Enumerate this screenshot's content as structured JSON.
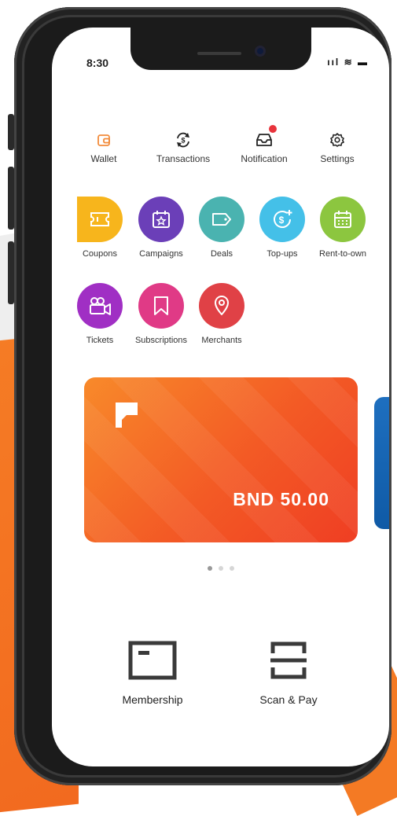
{
  "status_bar": {
    "time": "8:30",
    "indicators": "ııl ≋ ▬"
  },
  "quick_actions": [
    {
      "label": "Wallet",
      "icon": "wallet-icon",
      "color": "#f28b3a"
    },
    {
      "label": "Transactions",
      "icon": "transactions-icon",
      "color": "#222222"
    },
    {
      "label": "Notification",
      "icon": "inbox-icon",
      "color": "#222222",
      "has_badge": true
    },
    {
      "label": "Settings",
      "icon": "gear-icon",
      "color": "#222222"
    }
  ],
  "services": [
    {
      "label": "Coupons",
      "icon": "ticket-icon",
      "color": "#f7b51c"
    },
    {
      "label": "Campaigns",
      "icon": "calendar-star-icon",
      "color": "#6b3fb8"
    },
    {
      "label": "Deals",
      "icon": "tag-icon",
      "color": "#4ab3b0"
    },
    {
      "label": "Top-ups",
      "icon": "dollar-plus-icon",
      "color": "#44c0e8"
    },
    {
      "label": "Rent-to-own",
      "icon": "calendar-icon",
      "color": "#8cc63f"
    },
    {
      "label": "Tickets",
      "icon": "video-camera-icon",
      "color": "#a02fc4"
    },
    {
      "label": "Subscriptions",
      "icon": "bookmark-icon",
      "color": "#e03a86"
    },
    {
      "label": "Merchants",
      "icon": "location-pin-icon",
      "color": "#e04146"
    }
  ],
  "card": {
    "amount": "BND 50.00",
    "logo": "brand-p-logo"
  },
  "carousel": {
    "pages": 3,
    "active_index": 0
  },
  "bottom_actions": [
    {
      "label": "Membership",
      "icon": "membership-card-icon"
    },
    {
      "label": "Scan & Pay",
      "icon": "scan-icon"
    }
  ],
  "colors": {
    "accent": "#f35a25",
    "notification_badge": "#e8343c",
    "next_card": "#1e6fbf"
  }
}
